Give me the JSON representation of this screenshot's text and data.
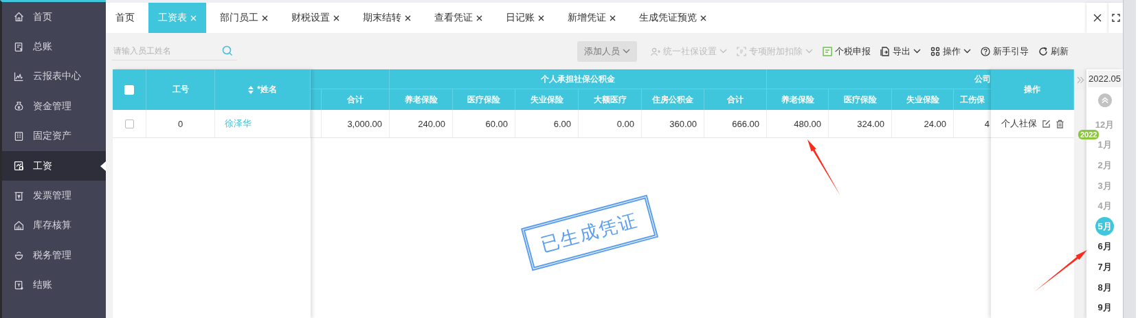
{
  "sidebar": {
    "items": [
      {
        "label": "首页",
        "selected": false
      },
      {
        "label": "总账",
        "selected": false
      },
      {
        "label": "云报表中心",
        "selected": false
      },
      {
        "label": "资金管理",
        "selected": false
      },
      {
        "label": "固定资产",
        "selected": false
      },
      {
        "label": "工资",
        "selected": true
      },
      {
        "label": "发票管理",
        "selected": false
      },
      {
        "label": "库存核算",
        "selected": false
      },
      {
        "label": "税务管理",
        "selected": false
      },
      {
        "label": "结账",
        "selected": false
      }
    ]
  },
  "tabs": [
    {
      "label": "首页",
      "closable": false,
      "selected": false
    },
    {
      "label": "工资表",
      "closable": true,
      "selected": true
    },
    {
      "label": "部门员工",
      "closable": true,
      "selected": false
    },
    {
      "label": "财税设置",
      "closable": true,
      "selected": false
    },
    {
      "label": "期末结转",
      "closable": true,
      "selected": false
    },
    {
      "label": "查看凭证",
      "closable": true,
      "selected": false
    },
    {
      "label": "日记账",
      "closable": true,
      "selected": false
    },
    {
      "label": "新增凭证",
      "closable": true,
      "selected": false
    },
    {
      "label": "生成凭证预览",
      "closable": true,
      "selected": false
    }
  ],
  "toolbar": {
    "search": {
      "placeholder": "请输入员工姓名"
    },
    "buttons": [
      {
        "label": "添加人员",
        "kind": "button",
        "dropdown": true,
        "disabled": true
      },
      {
        "label": "统一社保设置",
        "kind": "link",
        "dropdown": true,
        "disabled": true
      },
      {
        "label": "专项附加扣除",
        "kind": "link",
        "dropdown": true,
        "disabled": true
      },
      {
        "label": "个税申报",
        "kind": "link",
        "dropdown": false,
        "disabled": false
      },
      {
        "label": "导出",
        "kind": "link",
        "dropdown": true,
        "disabled": false
      },
      {
        "label": "操作",
        "kind": "link",
        "dropdown": true,
        "disabled": false
      },
      {
        "label": "新手引导",
        "kind": "link",
        "dropdown": false,
        "disabled": false
      },
      {
        "label": "刷新",
        "kind": "link",
        "dropdown": false,
        "disabled": false
      }
    ]
  },
  "table": {
    "select_all": {
      "checked": false
    },
    "fixed_columns": [
      "工号",
      "*姓名"
    ],
    "column_groups": [
      {
        "columns": [
          {},
          {
            "label": "合计"
          }
        ]
      },
      {
        "label": "个人承担社保公积金",
        "columns": [
          {
            "label": "养老保险"
          },
          {
            "label": "医疗保险"
          },
          {
            "label": "失业保险"
          },
          {
            "label": "大额医疗"
          },
          {
            "label": "住房公积金"
          },
          {
            "label": "合计"
          }
        ]
      },
      {
        "label": "公司",
        "columns": [
          {
            "label": "养老保险"
          },
          {
            "label": "医疗保险"
          },
          {
            "label": "失业保险"
          },
          {
            "label": "工伤保"
          }
        ]
      }
    ],
    "actions_column": {
      "label": "操作"
    },
    "rows": [
      {
        "checked": false,
        "id": "0",
        "name": "徐泽华",
        "action": "个人社保",
        "cells": [
          {},
          {
            "text": "3,000.00"
          },
          {
            "text": "240.00"
          },
          {
            "text": "60.00"
          },
          {
            "text": "6.00"
          },
          {
            "text": "0.00"
          },
          {
            "text": "360.00"
          },
          {
            "text": "666.00"
          },
          {
            "text": "480.00"
          },
          {
            "text": "324.00"
          },
          {
            "text": "24.00"
          },
          {
            "text": "4"
          }
        ]
      }
    ],
    "stamp": {
      "text": "已生成凭证"
    }
  },
  "period_panel": {
    "current": "2022.05",
    "months": [
      {
        "label": "12月",
        "selected": false,
        "dimmed": true
      },
      {
        "label": "1月",
        "badge": "2022",
        "selected": false,
        "dimmed": true
      },
      {
        "label": "2月",
        "selected": false,
        "dimmed": true
      },
      {
        "label": "3月",
        "selected": false,
        "dimmed": true
      },
      {
        "label": "4月",
        "selected": false,
        "dimmed": true
      },
      {
        "label": "5月",
        "selected": true,
        "dimmed": false
      },
      {
        "label": "6月",
        "selected": false,
        "dimmed": false
      },
      {
        "label": "7月",
        "selected": false,
        "dimmed": false
      },
      {
        "label": "8月",
        "selected": false,
        "dimmed": false
      },
      {
        "label": "9月",
        "selected": false,
        "dimmed": false
      }
    ]
  },
  "annotations": [
    {
      "kind": "arrow"
    },
    {
      "kind": "arrow"
    }
  ]
}
